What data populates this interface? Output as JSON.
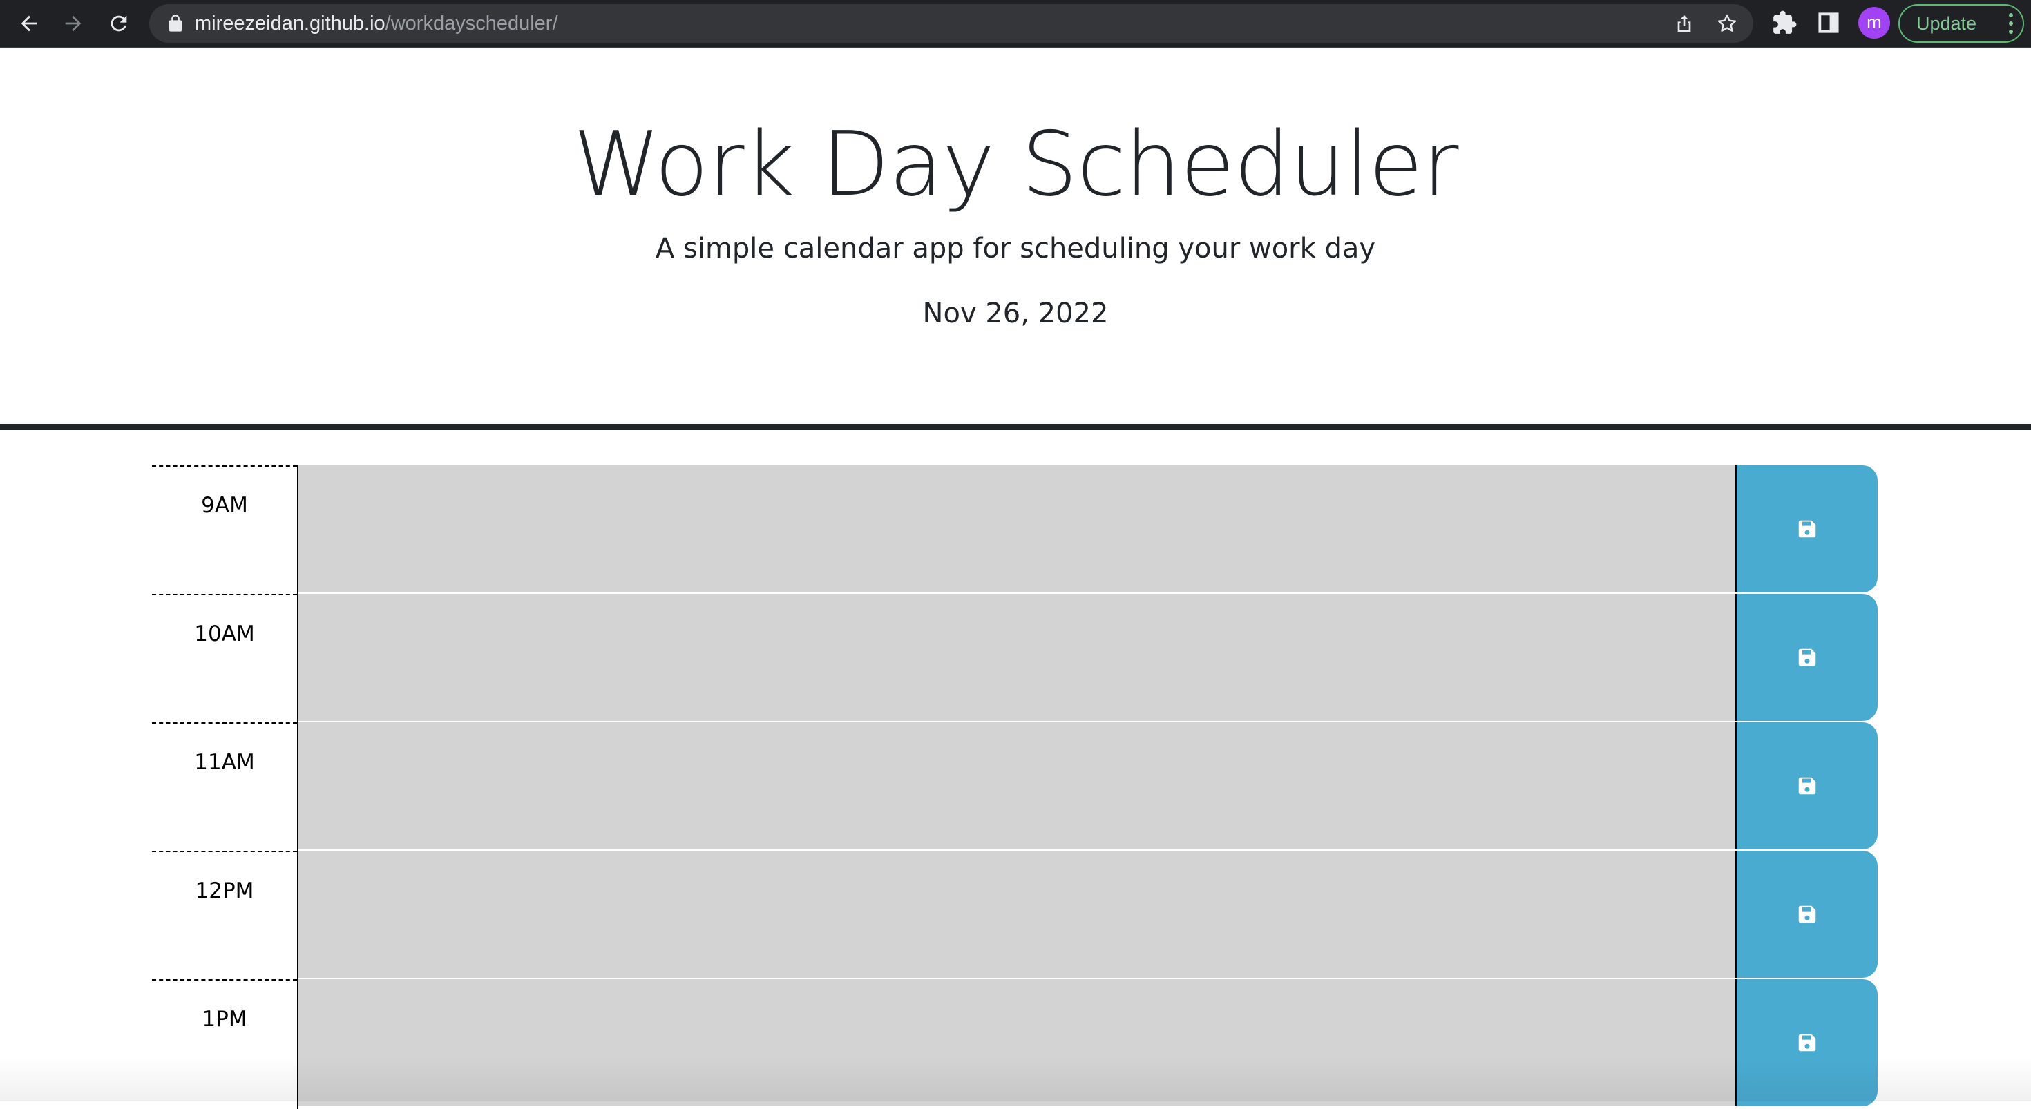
{
  "browser": {
    "url_host": "mireezeidan.github.io",
    "url_path": "/workdayscheduler/",
    "profile_initial": "m",
    "update_label": "Update",
    "icons": [
      "back-arrow-icon",
      "forward-arrow-icon",
      "reload-icon",
      "lock-icon",
      "share-icon",
      "star-icon",
      "extensions-puzzle-icon",
      "side-panel-icon",
      "kebab-menu-icon"
    ],
    "colors": {
      "toolbar": "#202124",
      "omnibox": "#35363a",
      "avatar": "#a142f4",
      "update_border": "#5bb974"
    }
  },
  "header": {
    "title": "Work Day Scheduler",
    "lead": "A simple calendar app for scheduling your work day",
    "current_day": "Nov 26, 2022"
  },
  "time_blocks": [
    {
      "hour": "9AM",
      "description": "",
      "state": "past"
    },
    {
      "hour": "10AM",
      "description": "",
      "state": "past"
    },
    {
      "hour": "11AM",
      "description": "",
      "state": "past"
    },
    {
      "hour": "12PM",
      "description": "",
      "state": "past"
    },
    {
      "hour": "1PM",
      "description": "",
      "state": "past"
    }
  ],
  "save_icon": "floppy-disk-icon",
  "colors": {
    "past": "#d3d3d3",
    "save_button": "#4aabd1",
    "header_rule": "#212529"
  }
}
